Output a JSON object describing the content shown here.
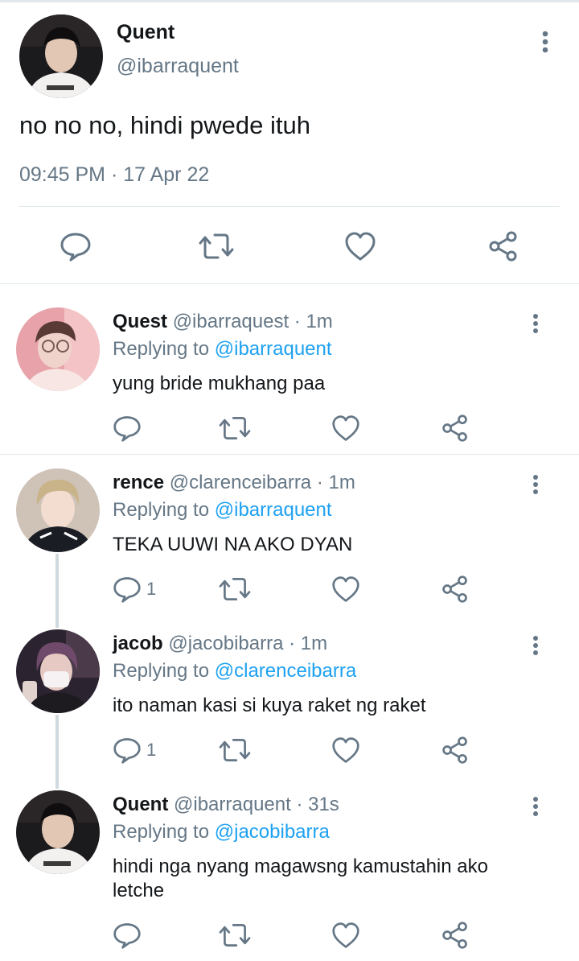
{
  "main_tweet": {
    "author_name": "Quent",
    "author_handle": "@ibarraquent",
    "text": "no no no, hindi pwede ituh",
    "timestamp": "09:45 PM · 17 Apr 22",
    "actions": [
      "reply-icon",
      "retweet-icon",
      "like-icon",
      "share-icon"
    ]
  },
  "replies": [
    {
      "name": "Quest",
      "handle": "@ibarraquest",
      "sep": " · ",
      "time": "1m",
      "replying_prefix": "Replying to ",
      "replying_to": "@ibarraquent",
      "text": "yung bride mukhang paa",
      "reply_count": ""
    },
    {
      "name": "rence",
      "handle": "@clarenceibarra",
      "sep": " · ",
      "time": "1m",
      "replying_prefix": "Replying to ",
      "replying_to": "@ibarraquent",
      "text": "TEKA UUWI NA AKO DYAN",
      "reply_count": "1"
    },
    {
      "name": "jacob",
      "handle": "@jacobibarra",
      "sep": " · ",
      "time": "1m",
      "replying_prefix": "Replying to ",
      "replying_to": "@clarenceibarra",
      "text": "ito naman kasi si kuya raket ng raket",
      "reply_count": "1"
    },
    {
      "name": "Quent",
      "handle": "@ibarraquent",
      "sep": " · ",
      "time": "31s",
      "replying_prefix": "Replying to ",
      "replying_to": "@jacobibarra",
      "text": "hindi nga nyang magawsng kamustahin ako letche",
      "reply_count": ""
    }
  ],
  "colors": {
    "text": "#14171a",
    "muted": "#657786",
    "mention": "#1da1f2",
    "divider": "#e1e8ed",
    "thread_line": "#cfd9de"
  }
}
